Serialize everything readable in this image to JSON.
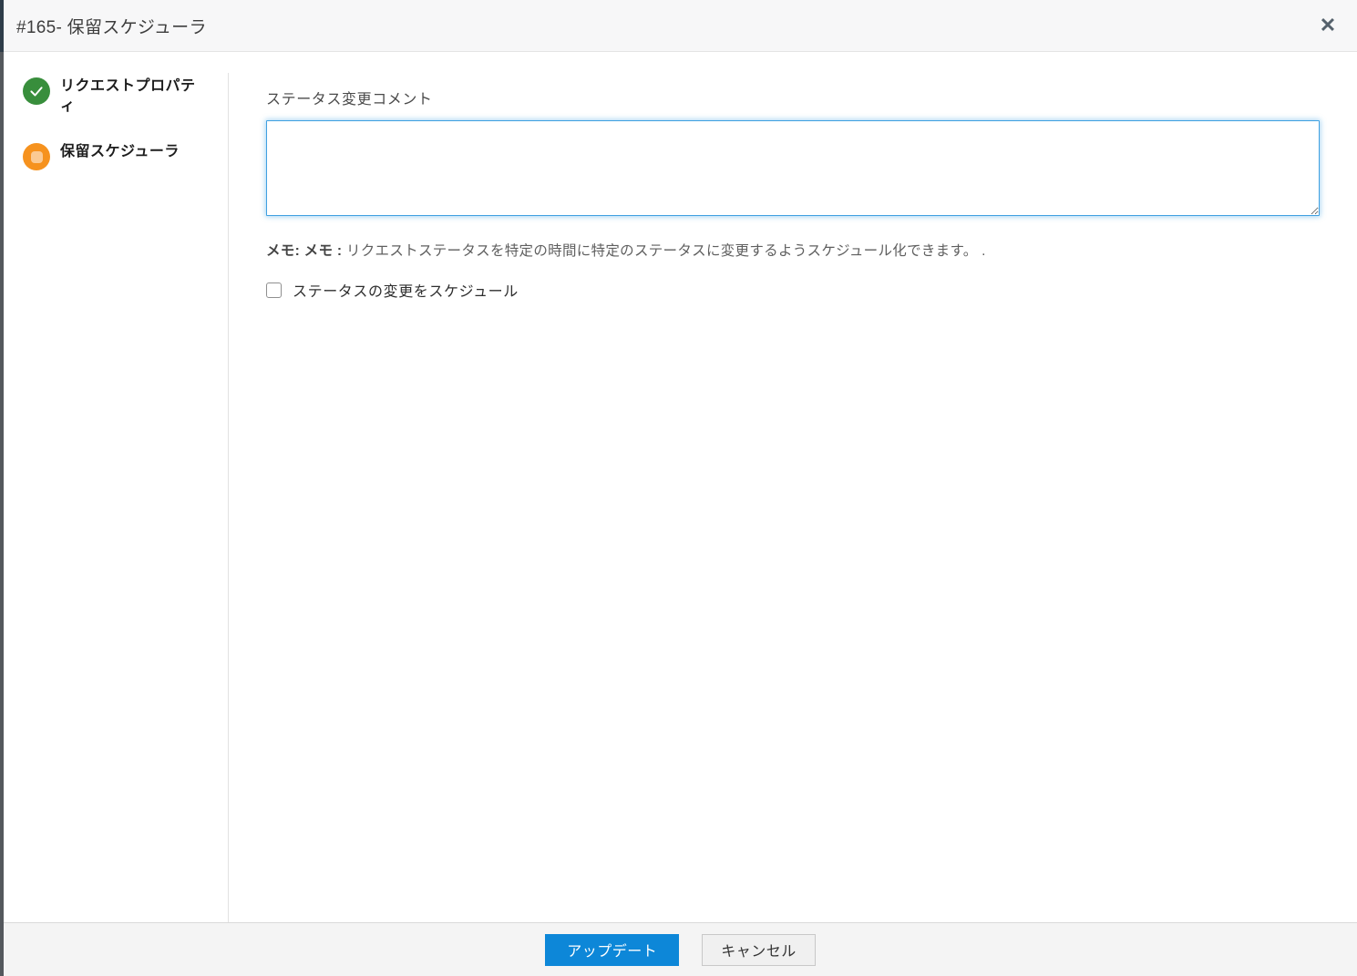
{
  "dialog": {
    "title": "#165- 保留スケジューラ",
    "close_icon": "close-icon"
  },
  "sidebar": {
    "steps": [
      {
        "label": "リクエストプロパティ",
        "status": "completed",
        "icon": "check-circle-icon",
        "color": "#388e3c"
      },
      {
        "label": "保留スケジューラ",
        "status": "current",
        "icon": "progress-circle-icon",
        "color": "#f6921e"
      }
    ]
  },
  "form": {
    "comment_label": "ステータス変更コメント",
    "comment_value": "",
    "note_bold1": "メモ:",
    "note_bold2": "メモ :",
    "note_body": "リクエストステータスを特定の時間に特定のステータスに変更するようスケジュール化できます。",
    "note_suffix": ".",
    "checkbox_label": "ステータスの変更をスケジュール",
    "checkbox_checked": false
  },
  "footer": {
    "update_label": "アップデート",
    "cancel_label": "キャンセル"
  },
  "colors": {
    "primary_button_blue": "#0d87d8",
    "textarea_focus_border": "#3fa0e1",
    "step_completed_green": "#388e3c",
    "step_current_orange": "#f6921e",
    "header_background": "#f7f7f8",
    "footer_background": "#f4f4f4"
  }
}
